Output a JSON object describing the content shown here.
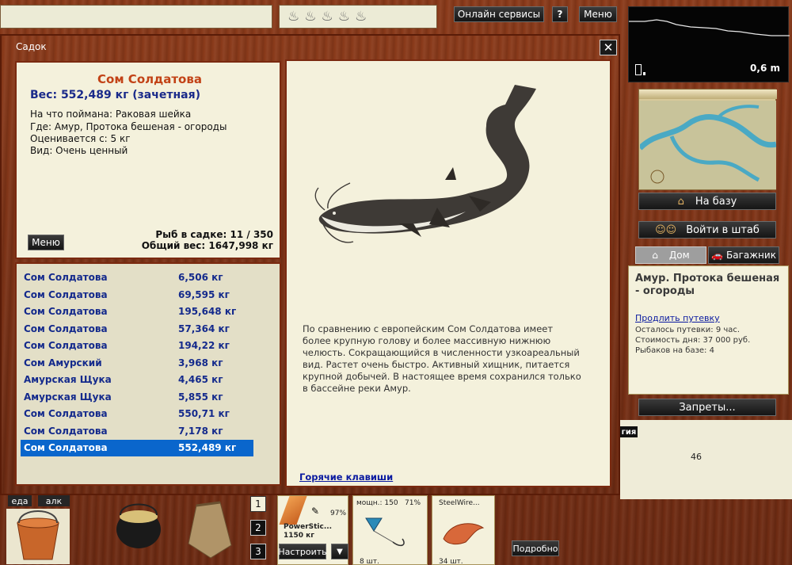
{
  "topbar": {
    "online_services": "Онлайн сервисы",
    "help": "?",
    "menu": "Меню"
  },
  "dialog": {
    "title": "Садок",
    "close": "✕"
  },
  "fish": {
    "name": "Сом Солдатова",
    "weight": "Вес: 552,489 кг (зачетная)",
    "bait": "На что поймана: Раковая шейка",
    "place": "Где: Амур, Протока бешеная - огороды",
    "valued": "Оценивается с: 5 кг",
    "kind": "Вид: Очень ценный",
    "menu_button": "Меню",
    "count": "Рыб в садке: 11 / 350",
    "total": "Общий вес: 1647,998 кг",
    "description": "По сравнению с европейским Сом Солдатова имеет более крупную голову и более массивную нижнюю челюсть. Сокращающийся в численности узкоареальный вид. Растет очень быстро. Активный хищник, питается крупной добычей. В настоящее время сохранился только в бассейне реки Амур.",
    "hotkeys": "Горячие клавиши"
  },
  "catch_list": [
    {
      "name": "Сом Солдатова",
      "weight": "6,506 кг"
    },
    {
      "name": "Сом Солдатова",
      "weight": "69,595 кг"
    },
    {
      "name": "Сом Солдатова",
      "weight": "195,648 кг"
    },
    {
      "name": "Сом Солдатова",
      "weight": "57,364 кг"
    },
    {
      "name": "Сом Солдатова",
      "weight": "194,22 кг"
    },
    {
      "name": "Сом Амурский",
      "weight": "3,968 кг"
    },
    {
      "name": "Амурская Щука",
      "weight": "4,465 кг"
    },
    {
      "name": "Амурская Щука",
      "weight": "5,855 кг"
    },
    {
      "name": "Сом Солдатова",
      "weight": "550,71 кг"
    },
    {
      "name": "Сом Солдатова",
      "weight": "7,178 кг"
    },
    {
      "name": "Сом Солдатова",
      "weight": "552,489 кг"
    }
  ],
  "selected_index": 10,
  "right": {
    "depth": "0,6 m",
    "to_base": "На базу",
    "enter_hq": "Войти в штаб",
    "tab_home": "Дом",
    "tab_trunk": "Багажник",
    "location": "Амур. Протока бешеная - огороды",
    "extend": "Продлить путевку",
    "left_time": "Осталось путевки: 9 час.",
    "day_cost": "Стоимость дня: 37 000 руб.",
    "fishers": "Рыбаков на базе: 4",
    "bans": "Запреты...",
    "stat_tab": "гия",
    "stat_value": "46"
  },
  "bottom": {
    "food": "еда",
    "alcohol": "алк",
    "slot1": "1",
    "slot2": "2",
    "slot3": "3",
    "rod_name": "PowerStic...",
    "rod_weight": "1150 кг",
    "rod_percent": "97%",
    "setup": "Настроить",
    "power": "мощн.: 150",
    "power_percent": "71%",
    "line": "SteelWire...",
    "hooks_count": "8 шт.",
    "bait_count": "34 шт.",
    "details": "Подробно"
  },
  "colors": {
    "wood": "#7a3216",
    "panel": "#f4f1dc",
    "selected": "#0a66cc",
    "link": "#0a1aa0",
    "name": "#c24216"
  }
}
